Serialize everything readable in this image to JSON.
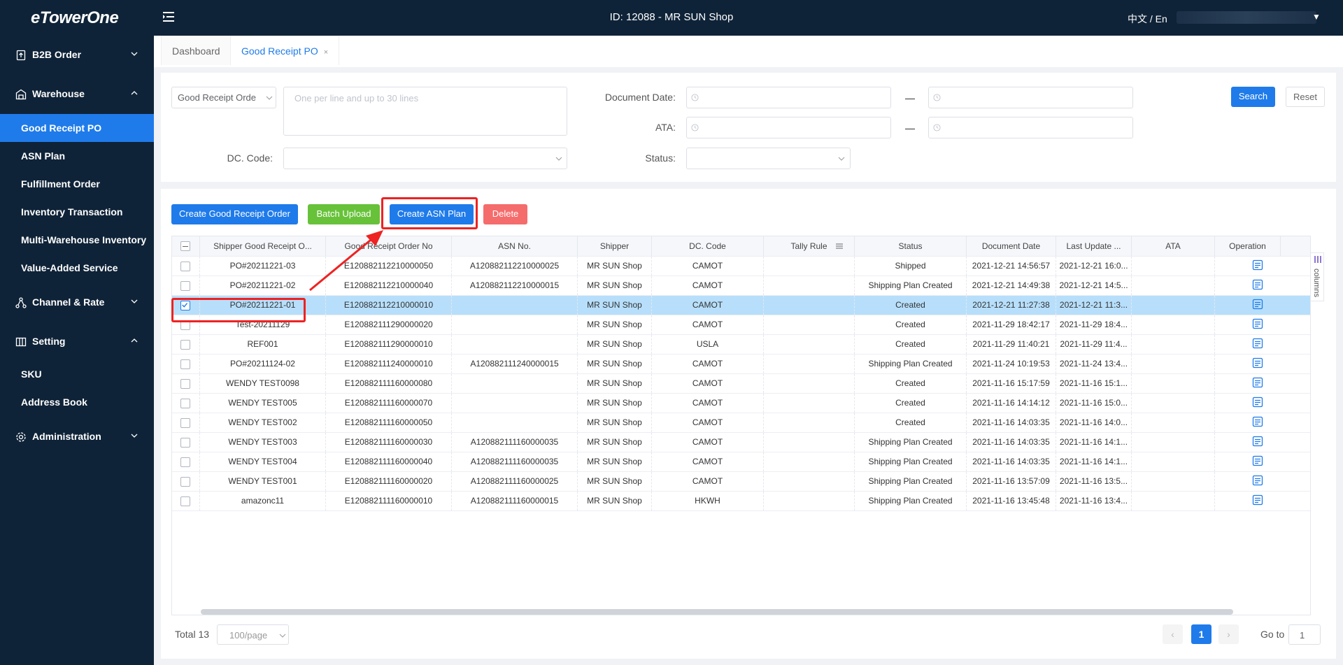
{
  "header": {
    "logo": "eTowerOne",
    "title": "ID: 12088 - MR SUN Shop",
    "lang": "中文 / En"
  },
  "sidebar": {
    "groups": [
      {
        "label": "B2B Order"
      },
      {
        "label": "Warehouse"
      },
      {
        "label": "Channel & Rate"
      },
      {
        "label": "Setting"
      },
      {
        "label": "Administration"
      }
    ],
    "warehouse_items": [
      "Good Receipt PO",
      "ASN Plan",
      "Fulfillment Order",
      "Inventory Transaction",
      "Multi-Warehouse Inventory",
      "Value-Added Service"
    ],
    "setting_items": [
      "SKU",
      "Address Book"
    ]
  },
  "tabs": {
    "dashboard": "Dashboard",
    "current": "Good Receipt PO",
    "close": "×"
  },
  "filters": {
    "search_type": "Good Receipt Orde",
    "search_placeholder": "One per line and up to 30 lines",
    "document_date_label": "Document Date:",
    "ata_label": "ATA:",
    "dc_code_label": "DC. Code:",
    "status_label": "Status:",
    "search_button": "Search",
    "reset_button": "Reset"
  },
  "toolbar": {
    "create_gro": "Create Good Receipt Order",
    "batch_upload": "Batch Upload",
    "create_asn": "Create ASN Plan",
    "delete": "Delete"
  },
  "table": {
    "columns": [
      "Shipper Good Receipt O...",
      "Good Receipt Order No",
      "ASN No.",
      "Shipper",
      "DC. Code",
      "Tally Rule",
      "Status",
      "Document Date",
      "Last Update ...",
      "ATA",
      "Operation"
    ],
    "rows": [
      {
        "ref": "PO#20211221-03",
        "gro": "E120882112210000050",
        "asn": "A120882112210000025",
        "shipper": "MR SUN Shop",
        "dc": "CAMOT",
        "tally": "",
        "status": "Shipped",
        "doc_date": "2021-12-21 14:56:57",
        "last_update": "2021-12-21 16:0...",
        "ata": "",
        "checked": false
      },
      {
        "ref": "PO#20211221-02",
        "gro": "E120882112210000040",
        "asn": "A120882112210000015",
        "shipper": "MR SUN Shop",
        "dc": "CAMOT",
        "tally": "",
        "status": "Shipping Plan Created",
        "doc_date": "2021-12-21 14:49:38",
        "last_update": "2021-12-21 14:5...",
        "ata": "",
        "checked": false
      },
      {
        "ref": "PO#20211221-01",
        "gro": "E120882112210000010",
        "asn": "",
        "shipper": "MR SUN Shop",
        "dc": "CAMOT",
        "tally": "",
        "status": "Created",
        "doc_date": "2021-12-21 11:27:38",
        "last_update": "2021-12-21 11:3...",
        "ata": "",
        "checked": true
      },
      {
        "ref": "Test-20211129",
        "gro": "E120882111290000020",
        "asn": "",
        "shipper": "MR SUN Shop",
        "dc": "CAMOT",
        "tally": "",
        "status": "Created",
        "doc_date": "2021-11-29 18:42:17",
        "last_update": "2021-11-29 18:4...",
        "ata": "",
        "checked": false
      },
      {
        "ref": "REF001",
        "gro": "E120882111290000010",
        "asn": "",
        "shipper": "MR SUN Shop",
        "dc": "USLA",
        "tally": "",
        "status": "Created",
        "doc_date": "2021-11-29 11:40:21",
        "last_update": "2021-11-29 11:4...",
        "ata": "",
        "checked": false
      },
      {
        "ref": "PO#20211124-02",
        "gro": "E120882111240000010",
        "asn": "A120882111240000015",
        "shipper": "MR SUN Shop",
        "dc": "CAMOT",
        "tally": "",
        "status": "Shipping Plan Created",
        "doc_date": "2021-11-24 10:19:53",
        "last_update": "2021-11-24 13:4...",
        "ata": "",
        "checked": false
      },
      {
        "ref": "WENDY TEST0098",
        "gro": "E120882111160000080",
        "asn": "",
        "shipper": "MR SUN Shop",
        "dc": "CAMOT",
        "tally": "",
        "status": "Created",
        "doc_date": "2021-11-16 15:17:59",
        "last_update": "2021-11-16 15:1...",
        "ata": "",
        "checked": false
      },
      {
        "ref": "WENDY TEST005",
        "gro": "E120882111160000070",
        "asn": "",
        "shipper": "MR SUN Shop",
        "dc": "CAMOT",
        "tally": "",
        "status": "Created",
        "doc_date": "2021-11-16 14:14:12",
        "last_update": "2021-11-16 15:0...",
        "ata": "",
        "checked": false
      },
      {
        "ref": "WENDY TEST002",
        "gro": "E120882111160000050",
        "asn": "",
        "shipper": "MR SUN Shop",
        "dc": "CAMOT",
        "tally": "",
        "status": "Created",
        "doc_date": "2021-11-16 14:03:35",
        "last_update": "2021-11-16 14:0...",
        "ata": "",
        "checked": false
      },
      {
        "ref": "WENDY TEST003",
        "gro": "E120882111160000030",
        "asn": "A120882111160000035",
        "shipper": "MR SUN Shop",
        "dc": "CAMOT",
        "tally": "",
        "status": "Shipping Plan Created",
        "doc_date": "2021-11-16 14:03:35",
        "last_update": "2021-11-16 14:1...",
        "ata": "",
        "checked": false
      },
      {
        "ref": "WENDY TEST004",
        "gro": "E120882111160000040",
        "asn": "A120882111160000035",
        "shipper": "MR SUN Shop",
        "dc": "CAMOT",
        "tally": "",
        "status": "Shipping Plan Created",
        "doc_date": "2021-11-16 14:03:35",
        "last_update": "2021-11-16 14:1...",
        "ata": "",
        "checked": false
      },
      {
        "ref": "WENDY TEST001",
        "gro": "E120882111160000020",
        "asn": "A120882111160000025",
        "shipper": "MR SUN Shop",
        "dc": "CAMOT",
        "tally": "",
        "status": "Shipping Plan Created",
        "doc_date": "2021-11-16 13:57:09",
        "last_update": "2021-11-16 13:5...",
        "ata": "",
        "checked": false
      },
      {
        "ref": "amazonc11",
        "gro": "E120882111160000010",
        "asn": "A120882111160000015",
        "shipper": "MR SUN Shop",
        "dc": "HKWH",
        "tally": "",
        "status": "Shipping Plan Created",
        "doc_date": "2021-11-16 13:45:48",
        "last_update": "2021-11-16 13:4...",
        "ata": "",
        "checked": false
      }
    ],
    "columns_toggle": "columns"
  },
  "footer": {
    "total": "Total 13",
    "page_size": "100/page",
    "current_page": "1",
    "goto_label": "Go to",
    "goto_value": "1"
  },
  "colors": {
    "sidebar_bg": "#0f2338",
    "accent": "#1f7bea",
    "selected_row": "#b7dffb",
    "annotation": "#e22222"
  }
}
